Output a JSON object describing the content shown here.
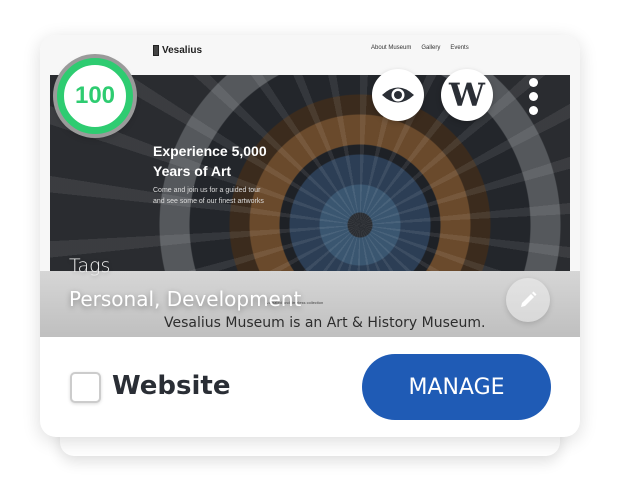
{
  "preview": {
    "logo": "Vesalius",
    "nav": [
      "About Museum",
      "Gallery",
      "Events"
    ],
    "hero_title_1": "Experience 5,000",
    "hero_title_2": "Years of Art",
    "hero_sub_1": "Come and join us for a guided tour",
    "hero_sub_2": "and see some of our finest artworks",
    "tiny_text": "A curated and timeless collection",
    "description": "Vesalius Museum is an Art & History Museum."
  },
  "tags": {
    "label": "Tags",
    "value": "Personal, Development"
  },
  "score": "100",
  "site": {
    "name": "Website",
    "manage_label": "MANAGE",
    "checked": false
  },
  "colors": {
    "score": "#2ecc71",
    "manage": "#1f5bb5"
  },
  "icons": [
    "eye-icon",
    "wordpress-icon",
    "more-vertical-icon",
    "pencil-icon"
  ]
}
